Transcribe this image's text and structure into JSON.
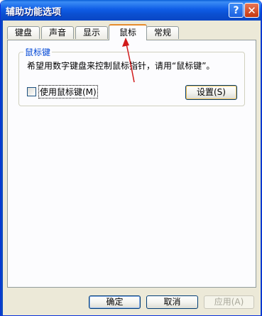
{
  "window": {
    "title": "辅助功能选项"
  },
  "tabs": [
    {
      "label": "键盘"
    },
    {
      "label": "声音"
    },
    {
      "label": "显示"
    },
    {
      "label": "鼠标",
      "active": true
    },
    {
      "label": "常规"
    }
  ],
  "mouse_keys": {
    "group_title": "鼠标键",
    "description": "希望用数字键盘来控制鼠标指针，请用“鼠标键”。",
    "checkbox_label": "使用鼠标键(M)",
    "checkbox_checked": false,
    "settings_button": "设置(S)"
  },
  "footer": {
    "ok": "确定",
    "cancel": "取消",
    "apply": "应用(A)"
  },
  "colors": {
    "titlebar": "#0a5fd8",
    "annotation_arrow": "#d11a1a",
    "group_title": "#0046d5"
  },
  "icons": {
    "help": "question-mark",
    "close": "x-mark"
  }
}
